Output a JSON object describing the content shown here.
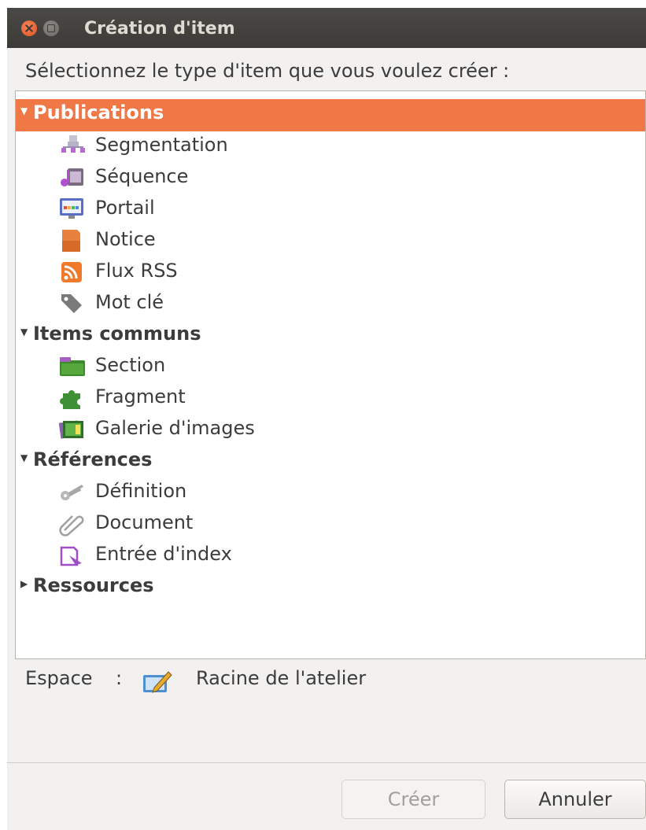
{
  "window": {
    "title": "Création d'item"
  },
  "prompt": "Sélectionnez le type d'item que vous voulez créer :",
  "tree": {
    "categories": [
      {
        "label": "Publications",
        "expanded": true,
        "selected": true,
        "items": [
          {
            "label": "Segmentation",
            "icon": "segmentation-icon"
          },
          {
            "label": "Séquence",
            "icon": "sequence-icon"
          },
          {
            "label": "Portail",
            "icon": "portal-icon"
          },
          {
            "label": "Notice",
            "icon": "notice-icon"
          },
          {
            "label": "Flux RSS",
            "icon": "rss-icon"
          },
          {
            "label": "Mot clé",
            "icon": "tag-icon"
          }
        ]
      },
      {
        "label": "Items communs",
        "expanded": true,
        "selected": false,
        "items": [
          {
            "label": "Section",
            "icon": "section-icon"
          },
          {
            "label": "Fragment",
            "icon": "puzzle-icon"
          },
          {
            "label": "Galerie d'images",
            "icon": "gallery-icon"
          }
        ]
      },
      {
        "label": "Références",
        "expanded": true,
        "selected": false,
        "items": [
          {
            "label": "Définition",
            "icon": "key-icon"
          },
          {
            "label": "Document",
            "icon": "paperclip-icon"
          },
          {
            "label": "Entrée d'index",
            "icon": "index-entry-icon"
          }
        ]
      },
      {
        "label": "Ressources",
        "expanded": false,
        "selected": false,
        "items": []
      }
    ]
  },
  "space": {
    "label": "Espace",
    "separator": ":",
    "icon": "workshop-edit-icon",
    "value": "Racine de l'atelier"
  },
  "buttons": {
    "create": {
      "label": "Créer",
      "enabled": false
    },
    "cancel": {
      "label": "Annuler",
      "enabled": true
    }
  },
  "colors": {
    "selection": "#f07746",
    "titlebar": "#3c3b37",
    "close": "#e0531e"
  }
}
